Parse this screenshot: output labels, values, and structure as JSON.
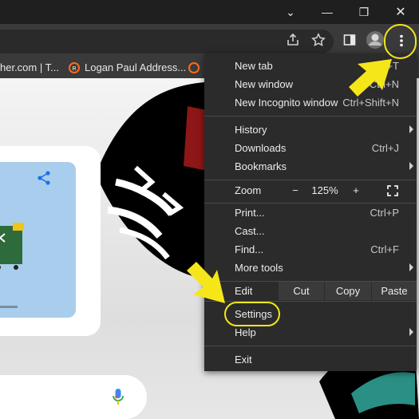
{
  "window": {
    "collapse_glyph": "⌄",
    "minimize_glyph": "—",
    "restore_glyph": "❐",
    "close_glyph": "✕"
  },
  "toolbar": {
    "icons": [
      "share-icon",
      "bookmark-star-icon",
      "side-panel-icon",
      "profile-avatar",
      "more-menu-icon"
    ]
  },
  "bookmarks": {
    "items": [
      {
        "label": "her.com | T..."
      },
      {
        "label": "Logan Paul Address..."
      }
    ]
  },
  "menu": {
    "new_tab": {
      "label": "New tab",
      "shortcut": "Ctrl+T"
    },
    "new_window": {
      "label": "New window",
      "shortcut": "Ctrl+N"
    },
    "new_incognito": {
      "label": "New Incognito window",
      "shortcut": "Ctrl+Shift+N"
    },
    "history": {
      "label": "History"
    },
    "downloads": {
      "label": "Downloads",
      "shortcut": "Ctrl+J"
    },
    "bookmarks": {
      "label": "Bookmarks"
    },
    "zoom": {
      "label": "Zoom",
      "minus": "−",
      "value": "125%",
      "plus": "+"
    },
    "print": {
      "label": "Print...",
      "shortcut": "Ctrl+P"
    },
    "cast": {
      "label": "Cast..."
    },
    "find": {
      "label": "Find...",
      "shortcut": "Ctrl+F"
    },
    "more_tools": {
      "label": "More tools"
    },
    "edit": {
      "label": "Edit",
      "cut": "Cut",
      "copy": "Copy",
      "paste": "Paste"
    },
    "settings": {
      "label": "Settings"
    },
    "help": {
      "label": "Help"
    },
    "exit": {
      "label": "Exit"
    }
  },
  "colors": {
    "annotation": "#f5e61a",
    "menu_bg": "#2b2b2b",
    "toolbar_bg": "#3a3a3a"
  }
}
